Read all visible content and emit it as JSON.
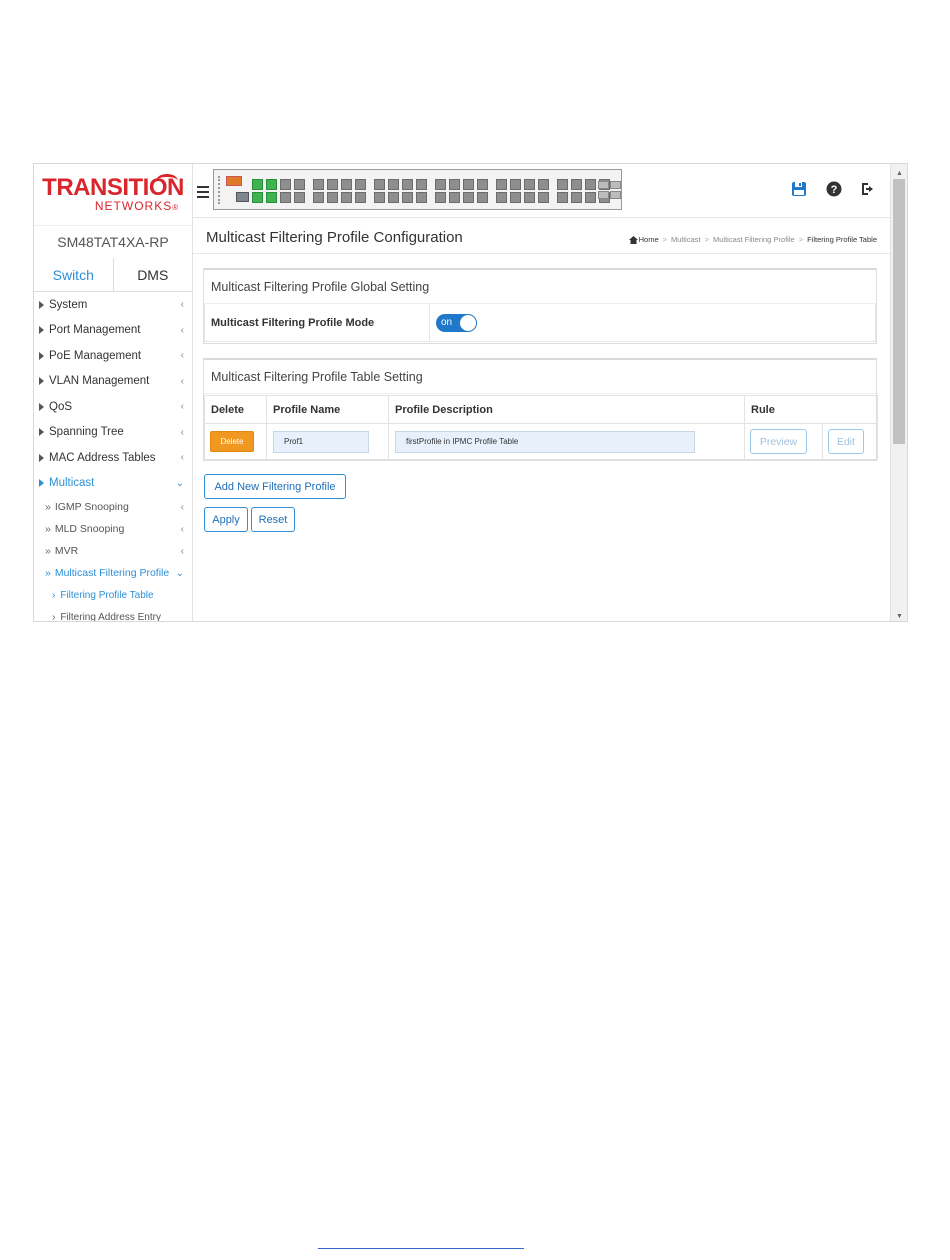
{
  "brand": {
    "name": "TRANSITION",
    "sub": "NETWORKS",
    "reg": "®"
  },
  "model": "SM48TAT4XA-RP",
  "tabs": [
    {
      "label": "Switch",
      "active": true
    },
    {
      "label": "DMS",
      "active": false
    }
  ],
  "menu": {
    "system": "System",
    "port_management": "Port Management",
    "poe_management": "PoE Management",
    "vlan_management": "VLAN Management",
    "qos": "QoS",
    "spanning_tree": "Spanning Tree",
    "mac_address_tables": "MAC Address Tables",
    "multicast": "Multicast",
    "igmp_snooping": "IGMP Snooping",
    "mld_snooping": "MLD Snooping",
    "mvr": "MVR",
    "multicast_filtering_profile": "Multicast Filtering Profile",
    "filtering_profile_table": "Filtering Profile Table",
    "filtering_address_entry": "Filtering Address Entry"
  },
  "glyphs": {
    "chev_left": "‹",
    "chev_down": "⌄",
    "dbl": "»",
    "ang": "›",
    "sep": ">"
  },
  "icons": {
    "save": "save-icon",
    "help": "help-icon",
    "logout": "logout-icon",
    "home": "home-icon"
  },
  "page": {
    "title": "Multicast Filtering Profile Configuration",
    "breadcrumb": {
      "home": "Home",
      "multicast": "Multicast",
      "profile": "Multicast Filtering Profile",
      "current": "Filtering Profile Table"
    }
  },
  "global_setting": {
    "title": "Multicast Filtering Profile Global Setting",
    "mode_label": "Multicast Filtering Profile Mode",
    "mode_value": "on"
  },
  "table_setting": {
    "title": "Multicast Filtering Profile Table Setting",
    "columns": {
      "delete": "Delete",
      "profile_name": "Profile Name",
      "profile_description": "Profile Description",
      "rule": "Rule"
    },
    "rows": [
      {
        "delete_label": "Delete",
        "profile_name": "Prof1",
        "profile_description": "firstProfile in IPMC Profile Table",
        "preview_label": "Preview",
        "edit_label": "Edit"
      }
    ]
  },
  "buttons": {
    "add_new": "Add New Filtering Profile",
    "apply": "Apply",
    "reset": "Reset"
  },
  "colors": {
    "accent": "#2d8fd5",
    "brand_red": "#d9262c",
    "delete_orange": "#f0981f",
    "port_up": "#3fb34f",
    "port_down": "#8e8e8e"
  }
}
